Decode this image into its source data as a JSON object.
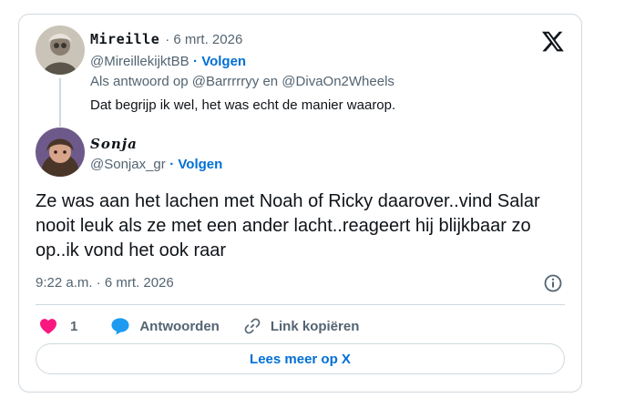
{
  "parent_tweet": {
    "display_name": "Mireille",
    "date": "· 6 mrt. 2026",
    "handle": "@MireillekijktBB",
    "follow_label": "· Volgen",
    "reply_to": "Als antwoord op @Barrrrryy en @DivaOn2Wheels",
    "text": "Dat begrijp ik wel, het was echt de manier waarop."
  },
  "reply_tweet": {
    "display_name": "Sonja",
    "handle": "@Sonjax_gr",
    "follow_label": "· Volgen",
    "text": "Ze was aan het lachen met Noah of Ricky daarover..vind Salar nooit leuk als ze met een ander lacht..reageert hij blijkbaar zo op..ik vond het ook raar",
    "timestamp": "9:22 a.m. · 6 mrt. 2026"
  },
  "actions": {
    "like_count": "1",
    "reply_label": "Antwoorden",
    "copy_link_label": "Link kopiëren"
  },
  "read_more_label": "Lees meer op X",
  "icons": {
    "logo": "x-logo-icon",
    "like": "heart-icon",
    "reply": "speech-bubble-icon",
    "copy": "link-icon",
    "info": "info-icon"
  },
  "colors": {
    "accent": "#006fd6",
    "like": "#f91880",
    "reply": "#1d9bf0",
    "muted": "#536471",
    "border": "#cfd9de"
  }
}
